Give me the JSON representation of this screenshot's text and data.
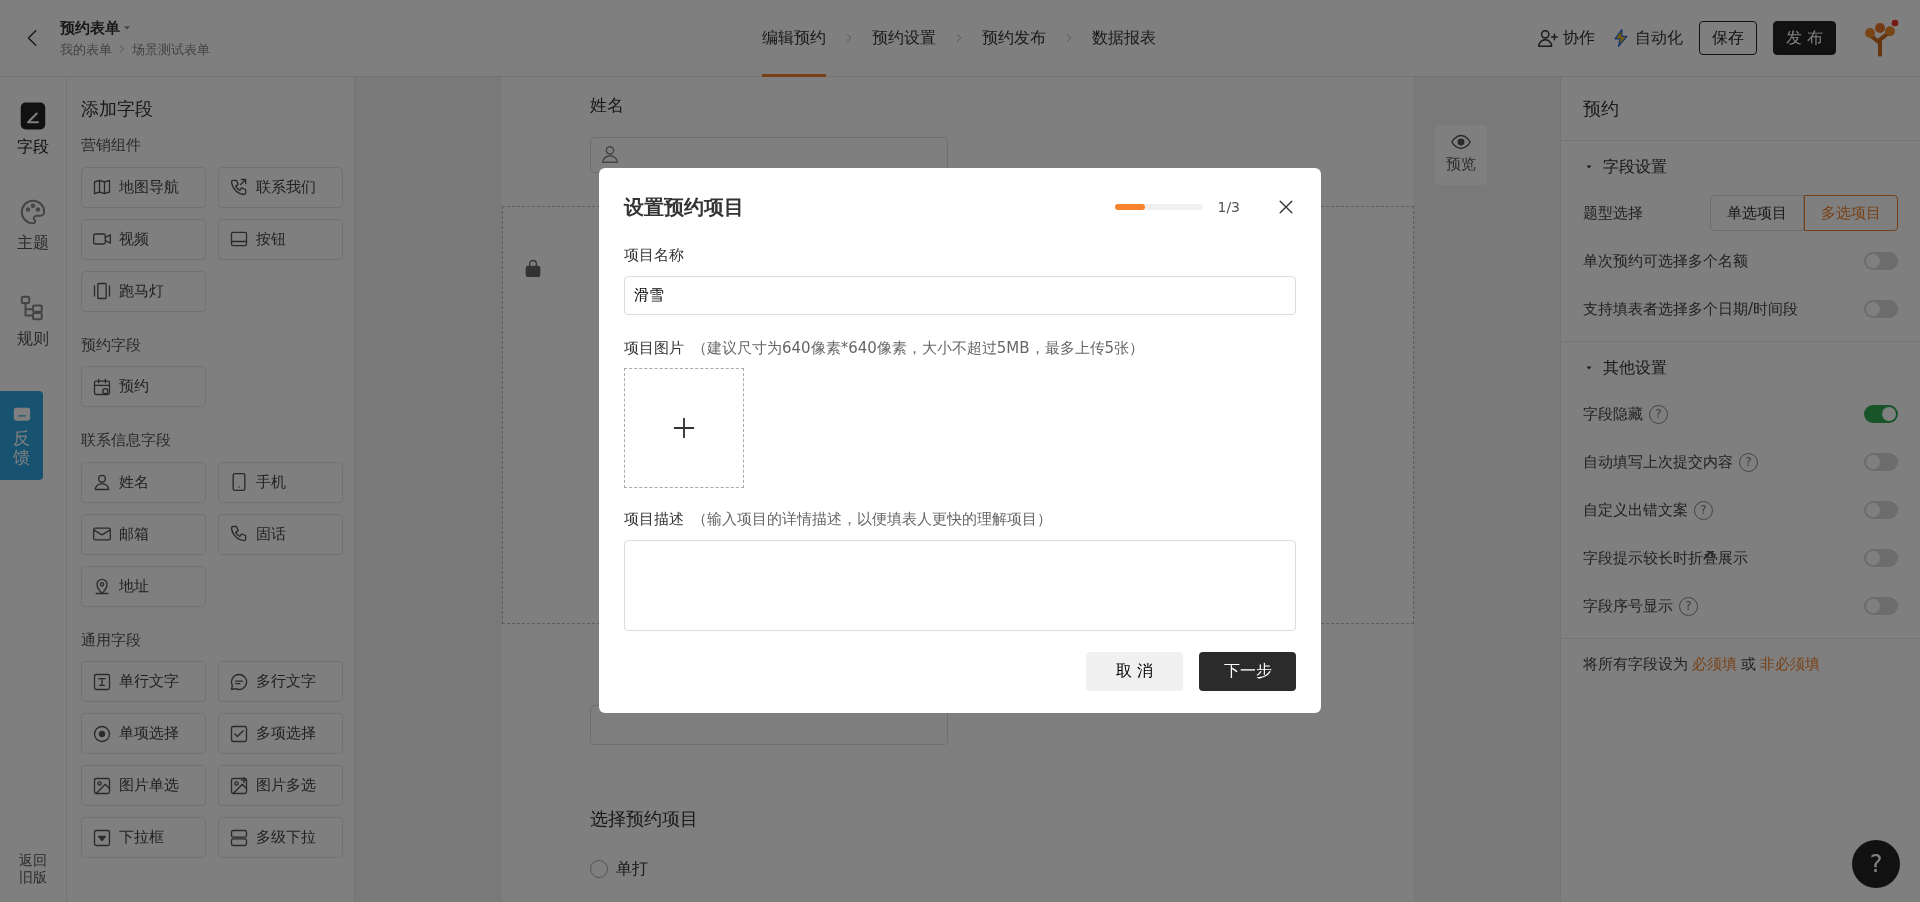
{
  "header": {
    "title": "预约表单",
    "breadcrumbs": [
      "我的表单",
      "场景测试表单"
    ],
    "steps": [
      {
        "label": "编辑预约",
        "selected": true
      },
      {
        "label": "预约设置",
        "selected": false
      },
      {
        "label": "预约发布",
        "selected": false
      },
      {
        "label": "数据报表",
        "selected": false
      }
    ],
    "collaborate": "协作",
    "automation": "自动化",
    "save": "保存",
    "publish": "发 布"
  },
  "rail": {
    "items": [
      {
        "label": "字段",
        "selected": true
      },
      {
        "label": "主题",
        "selected": false
      },
      {
        "label": "规则",
        "selected": false
      }
    ],
    "feedback": "反馈",
    "old_version": "返回旧版"
  },
  "sidebar": {
    "title": "添加字段",
    "groups": [
      {
        "title": "营销组件",
        "items": [
          "地图导航",
          "联系我们",
          "视频",
          "按钮",
          "跑马灯"
        ]
      },
      {
        "title": "预约字段",
        "items": [
          "预约"
        ]
      },
      {
        "title": "联系信息字段",
        "items": [
          "姓名",
          "手机",
          "邮箱",
          "固话",
          "地址"
        ]
      },
      {
        "title": "通用字段",
        "items": [
          "单行文字",
          "多行文字",
          "单项选择",
          "多项选择",
          "图片单选",
          "图片多选",
          "下拉框",
          "多级下拉"
        ]
      }
    ]
  },
  "canvas": {
    "name_label": "姓名",
    "section_title": "选择预约项目",
    "options": [
      {
        "label": "单打",
        "selected": false
      }
    ],
    "preview": "预览"
  },
  "settings": {
    "title": "预约",
    "sections": [
      {
        "title": "字段设置",
        "expanded": true,
        "rows": [
          {
            "kind": "segmented",
            "label": "题型选择",
            "options": [
              {
                "label": "单选项目",
                "selected": false
              },
              {
                "label": "多选项目",
                "selected": true
              }
            ]
          },
          {
            "kind": "toggle",
            "label": "单次预约可选择多个名额",
            "on": false
          },
          {
            "kind": "toggle",
            "label": "支持填表者选择多个日期/时间段",
            "on": false
          }
        ]
      },
      {
        "title": "其他设置",
        "expanded": true,
        "rows": [
          {
            "kind": "toggle",
            "label": "字段隐藏",
            "help": "?",
            "on": true
          },
          {
            "kind": "toggle",
            "label": "自动填写上次提交内容",
            "help": "?",
            "on": false
          },
          {
            "kind": "toggle",
            "label": "自定义出错文案",
            "help": "?",
            "on": false
          },
          {
            "kind": "toggle",
            "label": "字段提示较长时折叠展示",
            "on": false
          },
          {
            "kind": "toggle",
            "label": "字段序号显示",
            "help": "?",
            "on": false
          }
        ]
      }
    ],
    "footer": {
      "prefix": "将所有字段设为",
      "required": "必须填",
      "joiner": "或",
      "optional": "非必须填"
    }
  },
  "help": "?",
  "modal": {
    "title": "设置预约项目",
    "progress": {
      "level": 0.33,
      "reading": "1/3"
    },
    "name_label": "项目名称",
    "name_value": "滑雪",
    "image_label": "项目图片",
    "image_hint": "（建议尺寸为640像素*640像素，大小不超过5MB，最多上传5张）",
    "desc_label": "项目描述",
    "desc_hint": "（输入项目的详情描述，以便填表人更快的理解项目）",
    "cancel": "取 消",
    "next": "下一步"
  }
}
